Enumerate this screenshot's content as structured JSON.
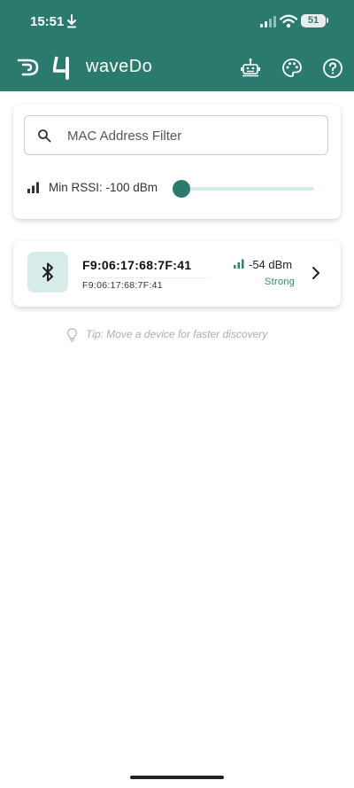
{
  "status_bar": {
    "time": "15:51",
    "battery": "51",
    "icons": [
      "download-icon",
      "cellular-signal-icon",
      "wifi-icon",
      "battery-icon"
    ]
  },
  "app_bar": {
    "title": "waveDo",
    "logo_icons": [
      "d-logo-icon",
      "four-logo-icon"
    ],
    "actions": [
      "robot-icon",
      "palette-icon",
      "help-icon"
    ]
  },
  "filter": {
    "search_placeholder": "MAC Address Filter",
    "search_value": "",
    "rssi_label": "Min RSSI: -100 dBm",
    "rssi_slider_fraction": 0.0
  },
  "devices": [
    {
      "name": "F9:06:17:68:7F:41",
      "mac": "F9:06:17:68:7F:41",
      "rssi": "-54 dBm",
      "quality": "Strong",
      "icon": "bluetooth-icon"
    }
  ],
  "tip": {
    "text": "Tip: Move a device for faster discovery",
    "icon": "lightbulb-icon"
  },
  "colors": {
    "primary": "#2a7a6e",
    "primary_light": "#d6ecea",
    "strong": "#2a8a6e",
    "tip_text": "#a9aeac"
  }
}
